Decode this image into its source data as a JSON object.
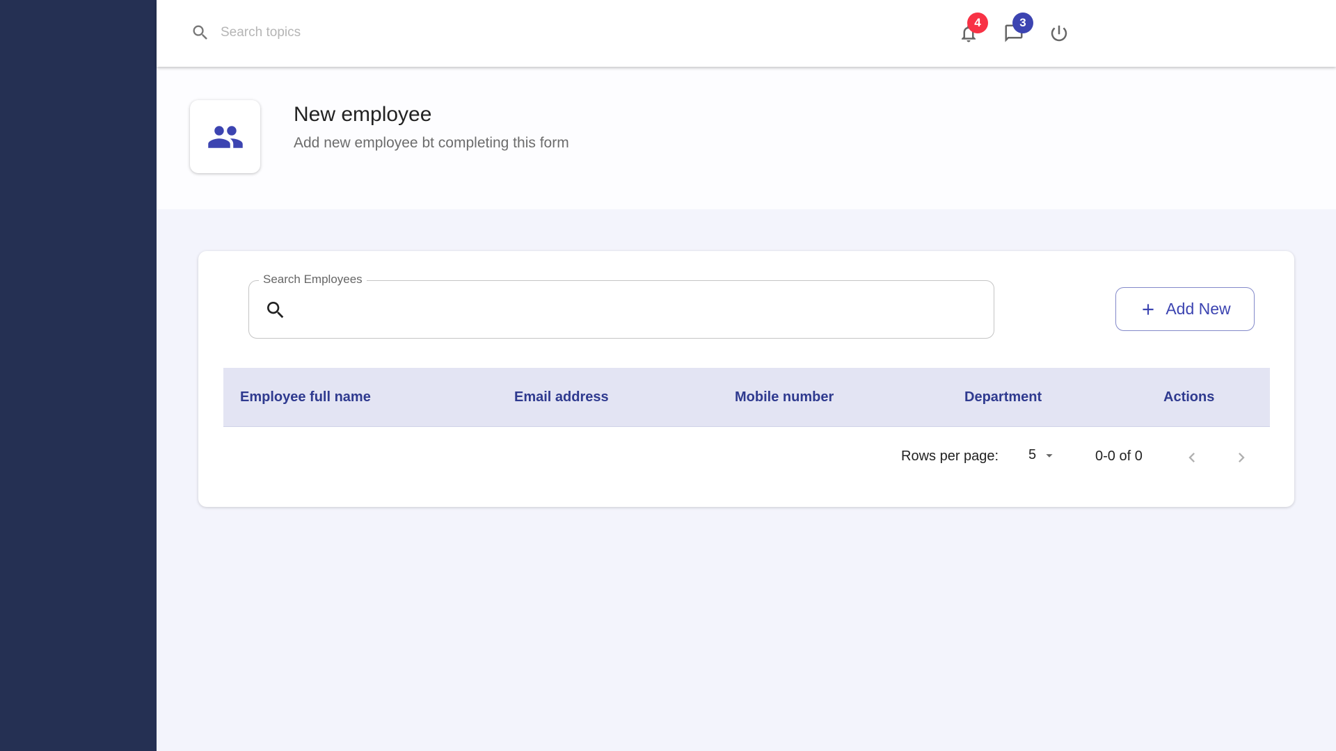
{
  "topbar": {
    "search_placeholder": "Search topics",
    "notifications_count": "4",
    "messages_count": "3"
  },
  "header": {
    "title": "New employee",
    "subtitle": "Add new employee bt completing this form"
  },
  "employee_search": {
    "label": "Search Employees",
    "value": ""
  },
  "add_button": {
    "label": "Add New"
  },
  "table": {
    "columns": [
      "Employee full name",
      "Email address",
      "Mobile number",
      "Department",
      "Actions"
    ],
    "rows": []
  },
  "pagination": {
    "rows_per_page_label": "Rows per page:",
    "rows_per_page_value": "5",
    "range": "0-0 of 0"
  },
  "colors": {
    "sidebar": "#253053",
    "accent": "#3c44b1",
    "badge_red": "#f83245",
    "table_header_bg": "#e3e4f3"
  }
}
